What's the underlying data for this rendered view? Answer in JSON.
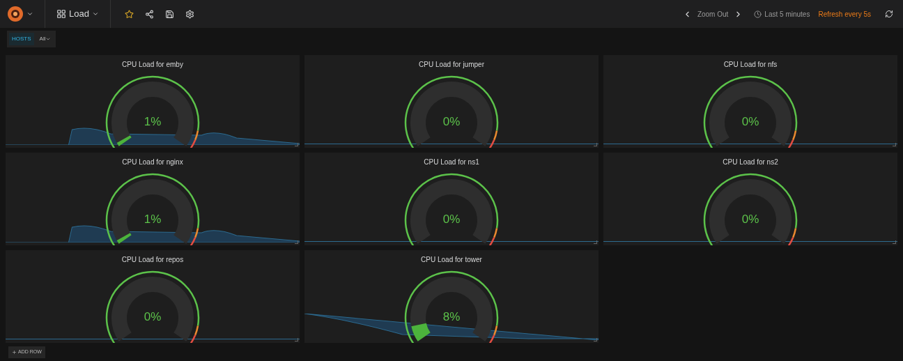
{
  "navbar": {
    "dashboard_title": "Load",
    "zoom_out": "Zoom Out",
    "time_range": "Last 5 minutes",
    "refresh": "Refresh every 5s"
  },
  "variables": [
    {
      "label": "HOSTS",
      "value": "All"
    }
  ],
  "panels": [
    {
      "title": "CPU Load for emby",
      "value": "1%"
    },
    {
      "title": "CPU Load for jumper",
      "value": "0%"
    },
    {
      "title": "CPU Load for nfs",
      "value": "0%"
    },
    {
      "title": "CPU Load for nginx",
      "value": "1%"
    },
    {
      "title": "CPU Load for ns1",
      "value": "0%"
    },
    {
      "title": "CPU Load for ns2",
      "value": "0%"
    },
    {
      "title": "CPU Load for repos",
      "value": "0%"
    },
    {
      "title": "CPU Load for tower",
      "value": "8%"
    }
  ],
  "add_row": "ADD ROW"
}
